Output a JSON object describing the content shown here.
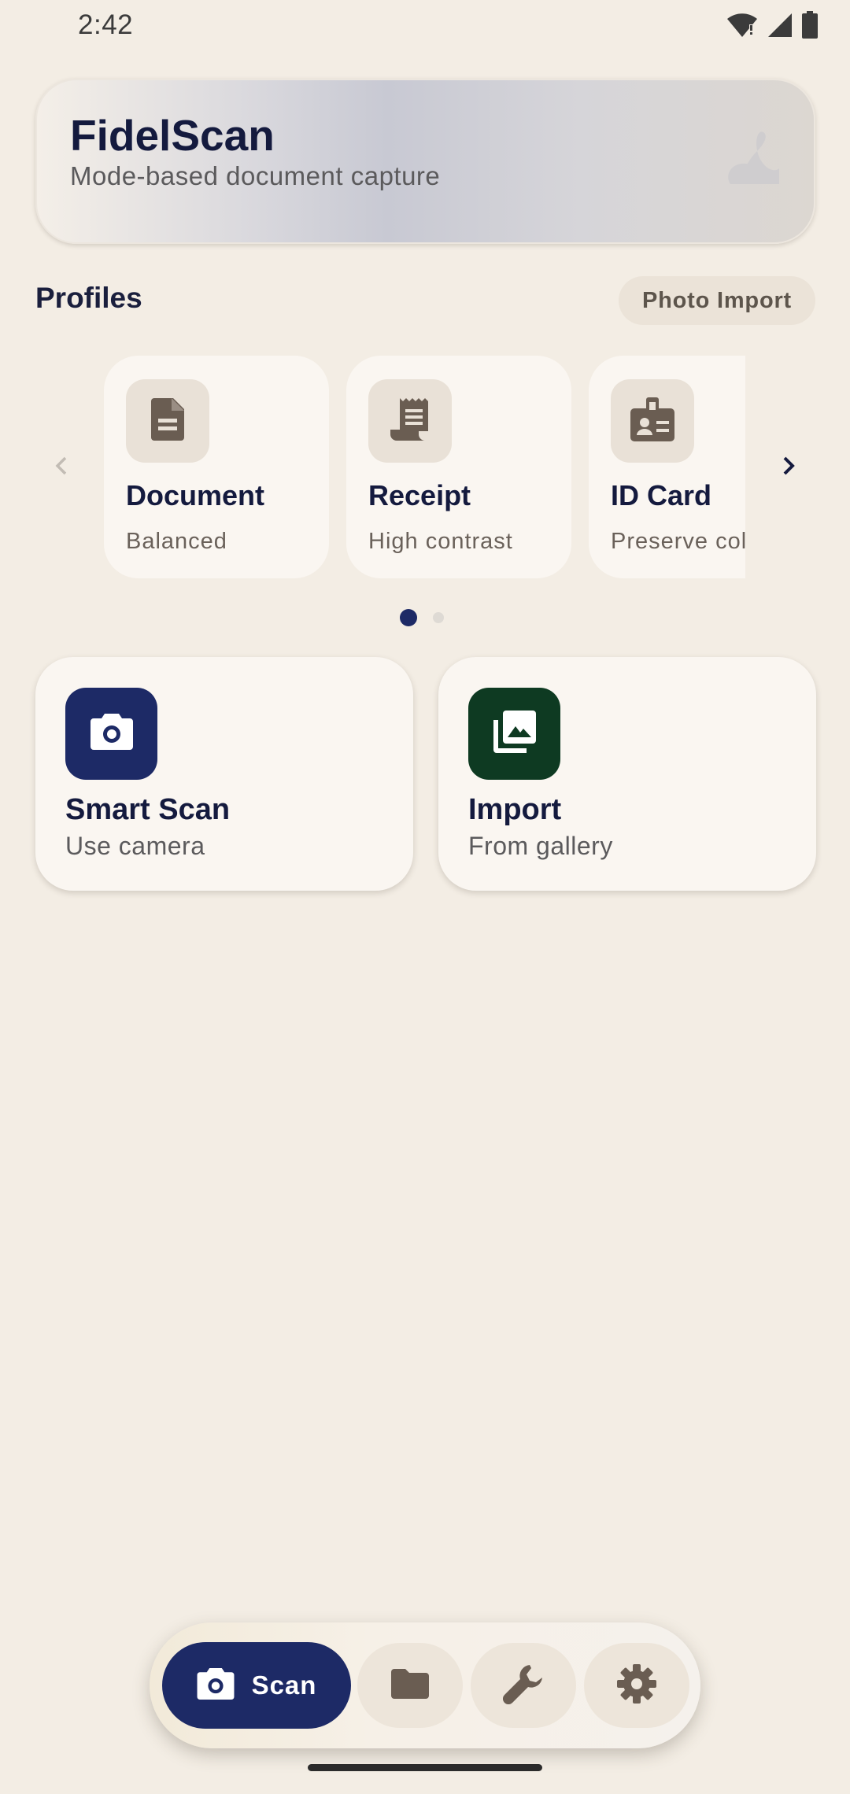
{
  "status_bar": {
    "time": "2:42"
  },
  "header": {
    "title": "FidelScan",
    "subtitle": "Mode-based document capture"
  },
  "profiles": {
    "section_title": "Profiles",
    "photo_import_label": "Photo Import",
    "items": [
      {
        "name": "Document",
        "desc": "Balanced",
        "icon": "document-icon"
      },
      {
        "name": "Receipt",
        "desc": "High contrast",
        "icon": "receipt-icon"
      },
      {
        "name": "ID Card",
        "desc": "Preserve color",
        "icon": "id-card-icon"
      }
    ],
    "page_count": 2,
    "active_page": 0
  },
  "actions": {
    "smart_scan": {
      "title": "Smart Scan",
      "subtitle": "Use camera",
      "color": "#1d2a66"
    },
    "import": {
      "title": "Import",
      "subtitle": "From gallery",
      "color": "#0e3a22"
    }
  },
  "bottom_nav": {
    "scan_label": "Scan",
    "items": [
      "camera-icon",
      "folder-icon",
      "wrench-icon",
      "settings-icon"
    ]
  }
}
